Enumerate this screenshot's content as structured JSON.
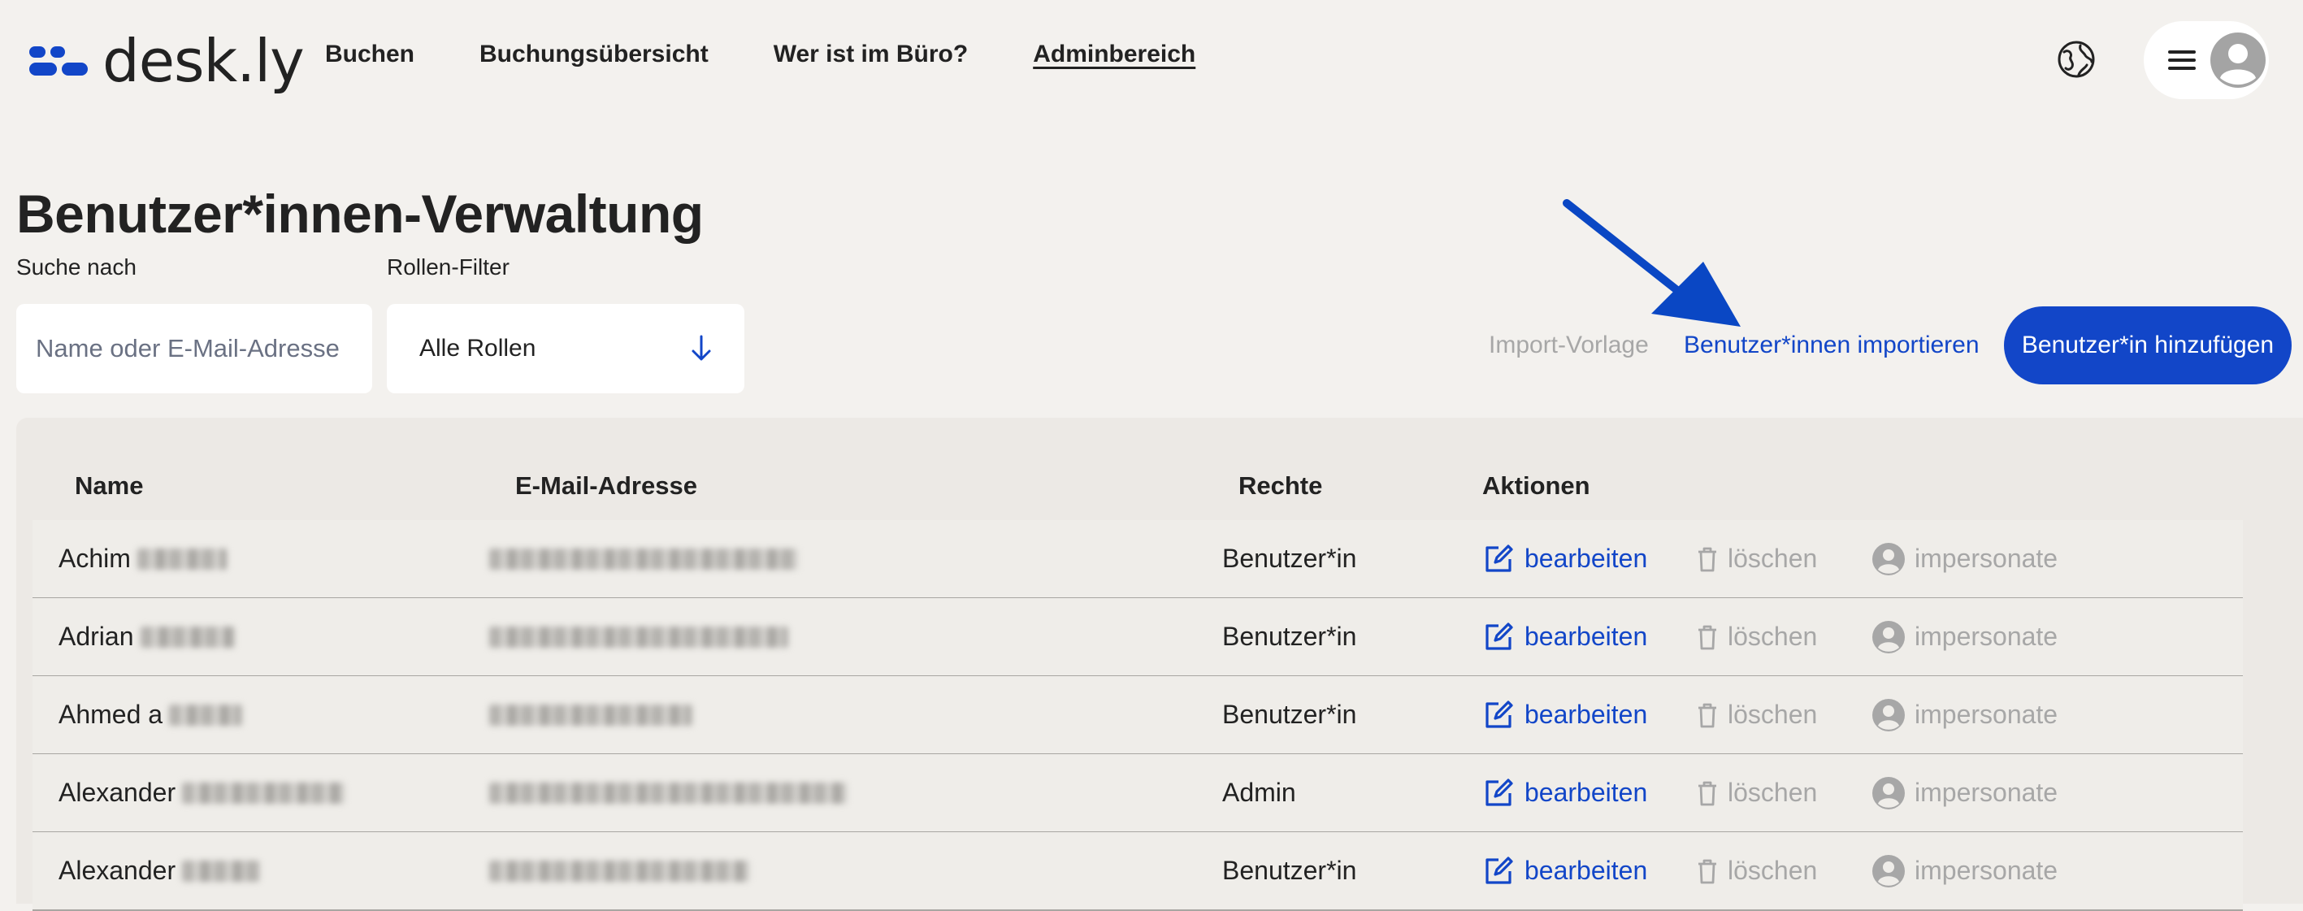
{
  "app": {
    "logo_text": "desk.ly",
    "brand_color": "#1246c8",
    "nav": [
      {
        "label": "Buchen",
        "active": false
      },
      {
        "label": "Buchungsübersicht",
        "active": false
      },
      {
        "label": "Wer ist im Büro?",
        "active": false
      },
      {
        "label": "Adminbereich",
        "active": true
      }
    ],
    "icons": {
      "language": "globe-icon",
      "menu": "hamburger-icon",
      "user": "avatar-icon"
    }
  },
  "page": {
    "title": "Benutzer*innen-Verwaltung",
    "search": {
      "label": "Suche nach",
      "placeholder": "Name oder E-Mail-Adresse",
      "value": ""
    },
    "role_filter": {
      "label": "Rollen-Filter",
      "selected": "Alle Rollen"
    },
    "actions": {
      "import_template": "Import-Vorlage",
      "import_users": "Benutzer*innen importieren",
      "add_user": "Benutzer*in hinzufügen"
    }
  },
  "table": {
    "columns": [
      "Name",
      "E-Mail-Adresse",
      "Rechte",
      "Aktionen"
    ],
    "action_labels": {
      "edit": "bearbeiten",
      "delete": "löschen",
      "impersonate": "impersonate"
    },
    "rows": [
      {
        "name": "Achim",
        "rights": "Benutzer*in"
      },
      {
        "name": "Adrian",
        "rights": "Benutzer*in"
      },
      {
        "name": "Ahmed a",
        "rights": "Benutzer*in"
      },
      {
        "name": "Alexander",
        "rights": "Admin"
      },
      {
        "name": "Alexander",
        "rights": "Benutzer*in"
      }
    ]
  }
}
